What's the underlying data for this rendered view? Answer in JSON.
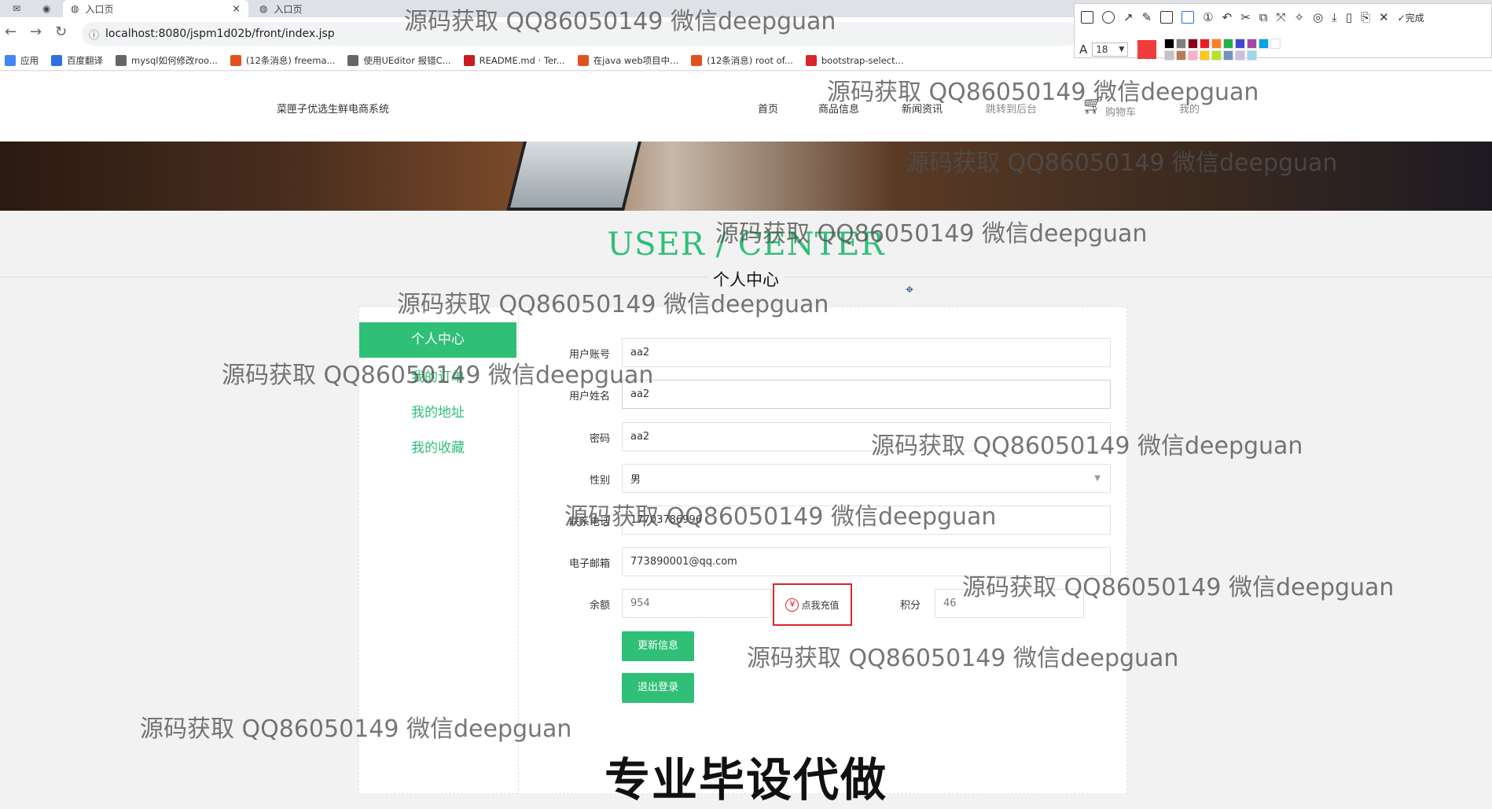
{
  "browser": {
    "tabs": [
      {
        "label": "入口页",
        "close": "×"
      },
      {
        "label": "入口页"
      }
    ],
    "url": "localhost:8080/jspm1d02b/front/index.jsp",
    "bookmarks": [
      {
        "label": "应用",
        "color": "#4285f4"
      },
      {
        "label": "百度翻译",
        "color": "#2f6fe4"
      },
      {
        "label": "mysql如何修改roo...",
        "color": "#666666"
      },
      {
        "label": "(12条消息) freema...",
        "color": "#e2511c"
      },
      {
        "label": "使用UEditor 报错C...",
        "color": "#666666"
      },
      {
        "label": "README.md · Ter...",
        "color": "#c71d23"
      },
      {
        "label": "在java web项目中...",
        "color": "#e2511c"
      },
      {
        "label": "(12条消息) root of...",
        "color": "#e2511c"
      },
      {
        "label": "bootstrap-select...",
        "color": "#d9262c"
      }
    ]
  },
  "snaptool": {
    "font_size": "18",
    "done_label": "完成",
    "colors": [
      "#f03c3c",
      "#000000",
      "#7f7f7f",
      "#880015",
      "#ed1c24",
      "#ff7f27",
      "#22b14c",
      "#3f48cc",
      "#a349a4",
      "#00a2e8",
      "#ffffff",
      "#c3c3c3",
      "#b97a57",
      "#ffaec9",
      "#ffc90e",
      "#b5e61d",
      "#7092be",
      "#c8bfe7",
      "#99d9ea"
    ]
  },
  "site": {
    "title": "菜匣子优选生鲜电商系统",
    "nav": [
      "首页",
      "商品信息",
      "新闻资讯",
      "跳转到后台",
      "购物车",
      "我的"
    ]
  },
  "section": {
    "title_en": "USER / CENTER",
    "title_cn": "个人中心"
  },
  "sidebar": {
    "active": "个人中心",
    "items": [
      "我的订单",
      "我的地址",
      "我的收藏"
    ]
  },
  "form": {
    "account_label": "用户账号",
    "account": "aa2",
    "name_label": "用户姓名",
    "name": "aa2",
    "password_label": "密码",
    "password": "aa2",
    "gender_label": "性别",
    "gender": "男",
    "phone_label": "联系电话",
    "phone": "17703786996",
    "email_label": "电子邮箱",
    "email": "773890001@qq.com",
    "balance_label": "余额",
    "balance": "954",
    "recharge_label": "点我充值",
    "points_label": "积分",
    "points": "46",
    "update_button": "更新信息",
    "logout_button": "退出登录"
  },
  "watermark": "源码获取 QQ86050149 微信deepguan",
  "bottom_banner": "专业毕设代做"
}
